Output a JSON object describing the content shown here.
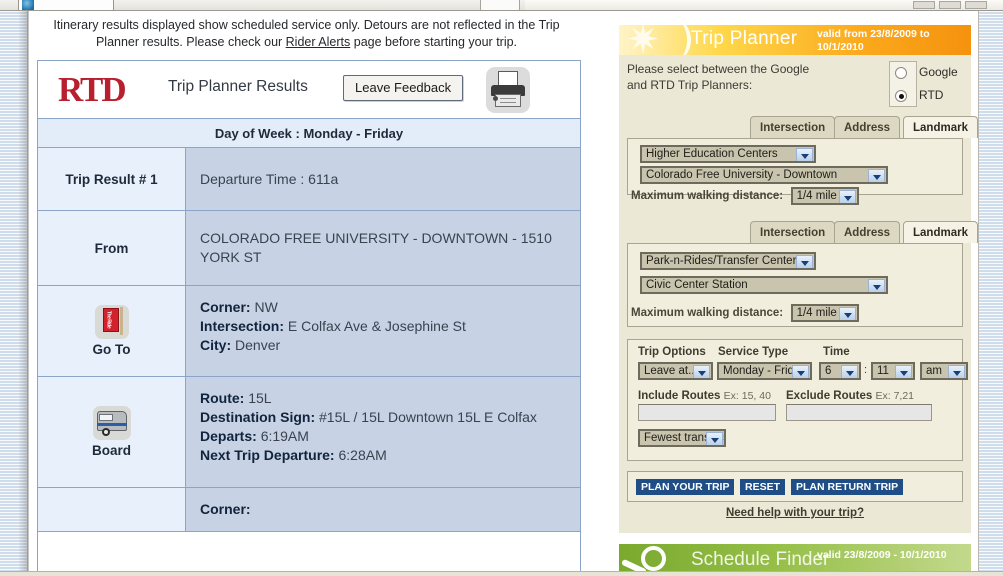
{
  "browser": {
    "window_buttons": [
      "minimize",
      "maximize",
      "close"
    ]
  },
  "alert": {
    "line1": "Itinerary results displayed show scheduled service only. Detours are not reflected in the Trip Planner",
    "line2_before": "results. Please check our ",
    "link": "Rider Alerts",
    "line2_after": " page before starting your trip."
  },
  "results": {
    "logo": "RTD",
    "title": "Trip Planner Results",
    "feedback_button": "Leave Feedback",
    "print_icon": "printer-icon",
    "day_of_week": "Day of Week : Monday - Friday",
    "rows": [
      {
        "label": "Trip Result # 1",
        "value": "Departure Time : 611a"
      },
      {
        "label": "From",
        "value": "COLORADO FREE UNIVERSITY - DOWNTOWN - 1510 YORK ST"
      },
      {
        "label": "Go To",
        "icon": "bus-stop-sign-icon",
        "fields": [
          {
            "key": "Corner:",
            "val": "NW"
          },
          {
            "key": "Intersection:",
            "val": "E Colfax Ave & Josephine St"
          },
          {
            "key": "City:",
            "val": "Denver"
          }
        ]
      },
      {
        "label": "Board",
        "icon": "bus-icon",
        "fields": [
          {
            "key": "Route:",
            "val": "15L"
          },
          {
            "key": "Destination Sign:",
            "val": "#15L / 15L Downtown 15L E Colfax"
          },
          {
            "key": "Departs:",
            "val": "6:19AM"
          },
          {
            "key": "Next Trip Departure:",
            "val": "6:28AM"
          }
        ]
      },
      {
        "label": "",
        "value": "Corner:"
      }
    ]
  },
  "sidebar": {
    "trip_planner": {
      "title": "Trip Planner",
      "valid": "valid from 23/8/2009 to 10/1/2010",
      "select_prompt_line1": "Please select between the Google",
      "select_prompt_line2": "and RTD Trip Planners:",
      "planner_options": [
        {
          "label": "Google",
          "checked": false
        },
        {
          "label": "RTD",
          "checked": true
        }
      ],
      "origin": {
        "tabs": [
          {
            "label": "Intersection",
            "active": false
          },
          {
            "label": "Address",
            "active": false
          },
          {
            "label": "Landmark",
            "active": true
          }
        ],
        "category_select": "Higher Education Centers",
        "place_select": "Colorado Free University - Downtown",
        "walk_label": "Maximum walking distance:",
        "walk_select": "1/4 mile"
      },
      "destination": {
        "tabs": [
          {
            "label": "Intersection",
            "active": false
          },
          {
            "label": "Address",
            "active": false
          },
          {
            "label": "Landmark",
            "active": true
          }
        ],
        "category_select": "Park-n-Rides/Transfer Centers",
        "place_select": "Civic Center Station",
        "walk_label": "Maximum walking distance:",
        "walk_select": "1/4 mile"
      },
      "options": {
        "trip_options_label": "Trip Options",
        "trip_options_select": "Leave at...",
        "service_type_label": "Service Type",
        "service_type_select": "Monday - Friday",
        "time_label": "Time",
        "time_hour": "6",
        "time_separator": ":",
        "time_minute": "11",
        "time_meridiem": "am",
        "include_label": "Include Routes",
        "include_example": "Ex: 15, 40",
        "include_value": "",
        "exclude_label": "Exclude Routes",
        "exclude_example": "Ex: 7,21",
        "exclude_value": "",
        "transfers_select": "Fewest transfers"
      },
      "actions": [
        {
          "label": "PLAN YOUR TRIP"
        },
        {
          "label": "RESET"
        },
        {
          "label": "PLAN RETURN TRIP"
        }
      ],
      "help_link": "Need help with your trip?"
    },
    "schedule_finder": {
      "title": "Schedule Finder",
      "valid": "valid 23/8/2009 - 10/1/2010",
      "icon": "magnifier-icon"
    }
  },
  "colors": {
    "rtd_red": "#b7202e",
    "tp_orange": "#f5920e",
    "sf_green": "#7aa92e",
    "action_blue": "#1f4e87",
    "table_value_bg": "#c7d3e4",
    "table_label_bg": "#e8f0fb"
  }
}
